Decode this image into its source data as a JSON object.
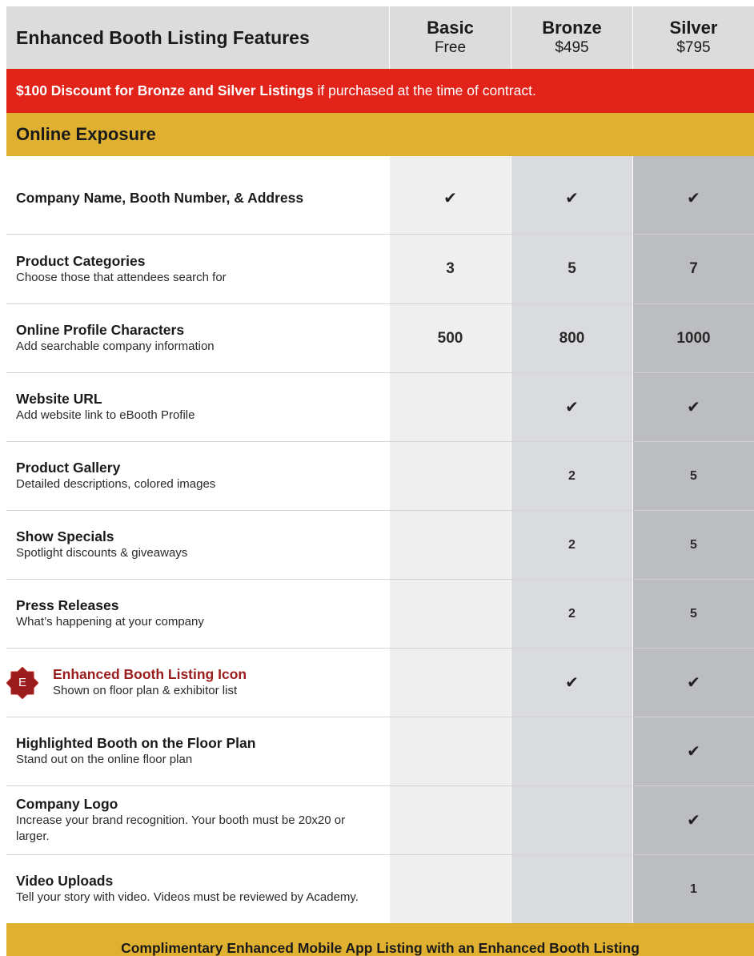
{
  "header": {
    "title": "Enhanced Booth Listing Features",
    "tiers": [
      {
        "name": "Basic",
        "price": "Free"
      },
      {
        "name": "Bronze",
        "price": "$495"
      },
      {
        "name": "Silver",
        "price": "$795"
      }
    ]
  },
  "promo": {
    "bold": "$100 Discount for Bronze and Silver Listings",
    "rest": "if purchased at the time of contract."
  },
  "section": {
    "title": "Online Exposure"
  },
  "colors": {
    "promo_bg": "#e2231a",
    "section_bg": "#e0b030",
    "basic_col": "#efefef",
    "bronze_col": "#dadbde",
    "silver_col": "#bcbdc1",
    "icon_red": "#9b1c1c"
  },
  "rows": [
    {
      "name": "Company Name, Booth Number, & Address",
      "desc": "",
      "basic": "✔",
      "bronze": "✔",
      "silver": "✔"
    },
    {
      "name": "Product Categories",
      "desc": "Choose those that attendees search for",
      "basic": "3",
      "bronze": "5",
      "silver": "7"
    },
    {
      "name": "Online Profile Characters",
      "desc": "Add searchable company information",
      "basic": "500",
      "bronze": "800",
      "silver": "1000"
    },
    {
      "name": "Website URL",
      "desc": "Add website link to eBooth Profile",
      "basic": "",
      "bronze": "✔",
      "silver": "✔"
    },
    {
      "name": "Product Gallery",
      "desc": "Detailed descriptions, colored images",
      "basic": "",
      "bronze": "2",
      "silver": "5"
    },
    {
      "name": "Show Specials",
      "desc": "Spotlight discounts & giveaways",
      "basic": "",
      "bronze": "2",
      "silver": "5"
    },
    {
      "name": "Press Releases",
      "desc": "What’s happening at your company",
      "basic": "",
      "bronze": "2",
      "silver": "5"
    },
    {
      "name": "Enhanced Booth Listing Icon",
      "desc": "Shown on floor plan & exhibitor list",
      "icon": "enhanced-badge-icon",
      "icon_letter": "E",
      "basic": "",
      "bronze": "✔",
      "silver": "✔"
    },
    {
      "name": "Highlighted Booth on the Floor Plan",
      "desc": "Stand out on the online floor plan",
      "basic": "",
      "bronze": "",
      "silver": "✔"
    },
    {
      "name": "Company Logo",
      "desc": "Increase your brand recognition. Your booth must be 20x20 or  larger.",
      "basic": "",
      "bronze": "",
      "silver": "✔"
    },
    {
      "name": "Video Uploads",
      "desc": "Tell your story with video. Videos must be reviewed by Academy.",
      "basic": "",
      "bronze": "",
      "silver": "1"
    }
  ],
  "footer": {
    "text": "Complimentary Enhanced Mobile App Listing with an Enhanced Booth Listing"
  }
}
